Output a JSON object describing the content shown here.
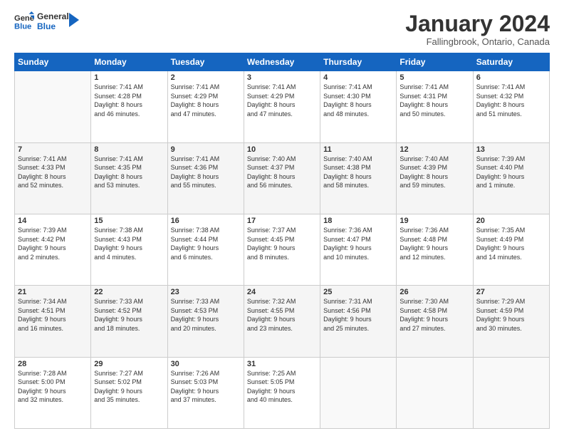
{
  "header": {
    "logo_line1": "General",
    "logo_line2": "Blue",
    "month": "January 2024",
    "location": "Fallingbrook, Ontario, Canada"
  },
  "weekdays": [
    "Sunday",
    "Monday",
    "Tuesday",
    "Wednesday",
    "Thursday",
    "Friday",
    "Saturday"
  ],
  "weeks": [
    [
      {
        "day": "",
        "info": ""
      },
      {
        "day": "1",
        "info": "Sunrise: 7:41 AM\nSunset: 4:28 PM\nDaylight: 8 hours\nand 46 minutes."
      },
      {
        "day": "2",
        "info": "Sunrise: 7:41 AM\nSunset: 4:29 PM\nDaylight: 8 hours\nand 47 minutes."
      },
      {
        "day": "3",
        "info": "Sunrise: 7:41 AM\nSunset: 4:29 PM\nDaylight: 8 hours\nand 47 minutes."
      },
      {
        "day": "4",
        "info": "Sunrise: 7:41 AM\nSunset: 4:30 PM\nDaylight: 8 hours\nand 48 minutes."
      },
      {
        "day": "5",
        "info": "Sunrise: 7:41 AM\nSunset: 4:31 PM\nDaylight: 8 hours\nand 50 minutes."
      },
      {
        "day": "6",
        "info": "Sunrise: 7:41 AM\nSunset: 4:32 PM\nDaylight: 8 hours\nand 51 minutes."
      }
    ],
    [
      {
        "day": "7",
        "info": "Sunrise: 7:41 AM\nSunset: 4:33 PM\nDaylight: 8 hours\nand 52 minutes."
      },
      {
        "day": "8",
        "info": "Sunrise: 7:41 AM\nSunset: 4:35 PM\nDaylight: 8 hours\nand 53 minutes."
      },
      {
        "day": "9",
        "info": "Sunrise: 7:41 AM\nSunset: 4:36 PM\nDaylight: 8 hours\nand 55 minutes."
      },
      {
        "day": "10",
        "info": "Sunrise: 7:40 AM\nSunset: 4:37 PM\nDaylight: 8 hours\nand 56 minutes."
      },
      {
        "day": "11",
        "info": "Sunrise: 7:40 AM\nSunset: 4:38 PM\nDaylight: 8 hours\nand 58 minutes."
      },
      {
        "day": "12",
        "info": "Sunrise: 7:40 AM\nSunset: 4:39 PM\nDaylight: 8 hours\nand 59 minutes."
      },
      {
        "day": "13",
        "info": "Sunrise: 7:39 AM\nSunset: 4:40 PM\nDaylight: 9 hours\nand 1 minute."
      }
    ],
    [
      {
        "day": "14",
        "info": "Sunrise: 7:39 AM\nSunset: 4:42 PM\nDaylight: 9 hours\nand 2 minutes."
      },
      {
        "day": "15",
        "info": "Sunrise: 7:38 AM\nSunset: 4:43 PM\nDaylight: 9 hours\nand 4 minutes."
      },
      {
        "day": "16",
        "info": "Sunrise: 7:38 AM\nSunset: 4:44 PM\nDaylight: 9 hours\nand 6 minutes."
      },
      {
        "day": "17",
        "info": "Sunrise: 7:37 AM\nSunset: 4:45 PM\nDaylight: 9 hours\nand 8 minutes."
      },
      {
        "day": "18",
        "info": "Sunrise: 7:36 AM\nSunset: 4:47 PM\nDaylight: 9 hours\nand 10 minutes."
      },
      {
        "day": "19",
        "info": "Sunrise: 7:36 AM\nSunset: 4:48 PM\nDaylight: 9 hours\nand 12 minutes."
      },
      {
        "day": "20",
        "info": "Sunrise: 7:35 AM\nSunset: 4:49 PM\nDaylight: 9 hours\nand 14 minutes."
      }
    ],
    [
      {
        "day": "21",
        "info": "Sunrise: 7:34 AM\nSunset: 4:51 PM\nDaylight: 9 hours\nand 16 minutes."
      },
      {
        "day": "22",
        "info": "Sunrise: 7:33 AM\nSunset: 4:52 PM\nDaylight: 9 hours\nand 18 minutes."
      },
      {
        "day": "23",
        "info": "Sunrise: 7:33 AM\nSunset: 4:53 PM\nDaylight: 9 hours\nand 20 minutes."
      },
      {
        "day": "24",
        "info": "Sunrise: 7:32 AM\nSunset: 4:55 PM\nDaylight: 9 hours\nand 23 minutes."
      },
      {
        "day": "25",
        "info": "Sunrise: 7:31 AM\nSunset: 4:56 PM\nDaylight: 9 hours\nand 25 minutes."
      },
      {
        "day": "26",
        "info": "Sunrise: 7:30 AM\nSunset: 4:58 PM\nDaylight: 9 hours\nand 27 minutes."
      },
      {
        "day": "27",
        "info": "Sunrise: 7:29 AM\nSunset: 4:59 PM\nDaylight: 9 hours\nand 30 minutes."
      }
    ],
    [
      {
        "day": "28",
        "info": "Sunrise: 7:28 AM\nSunset: 5:00 PM\nDaylight: 9 hours\nand 32 minutes."
      },
      {
        "day": "29",
        "info": "Sunrise: 7:27 AM\nSunset: 5:02 PM\nDaylight: 9 hours\nand 35 minutes."
      },
      {
        "day": "30",
        "info": "Sunrise: 7:26 AM\nSunset: 5:03 PM\nDaylight: 9 hours\nand 37 minutes."
      },
      {
        "day": "31",
        "info": "Sunrise: 7:25 AM\nSunset: 5:05 PM\nDaylight: 9 hours\nand 40 minutes."
      },
      {
        "day": "",
        "info": ""
      },
      {
        "day": "",
        "info": ""
      },
      {
        "day": "",
        "info": ""
      }
    ]
  ]
}
